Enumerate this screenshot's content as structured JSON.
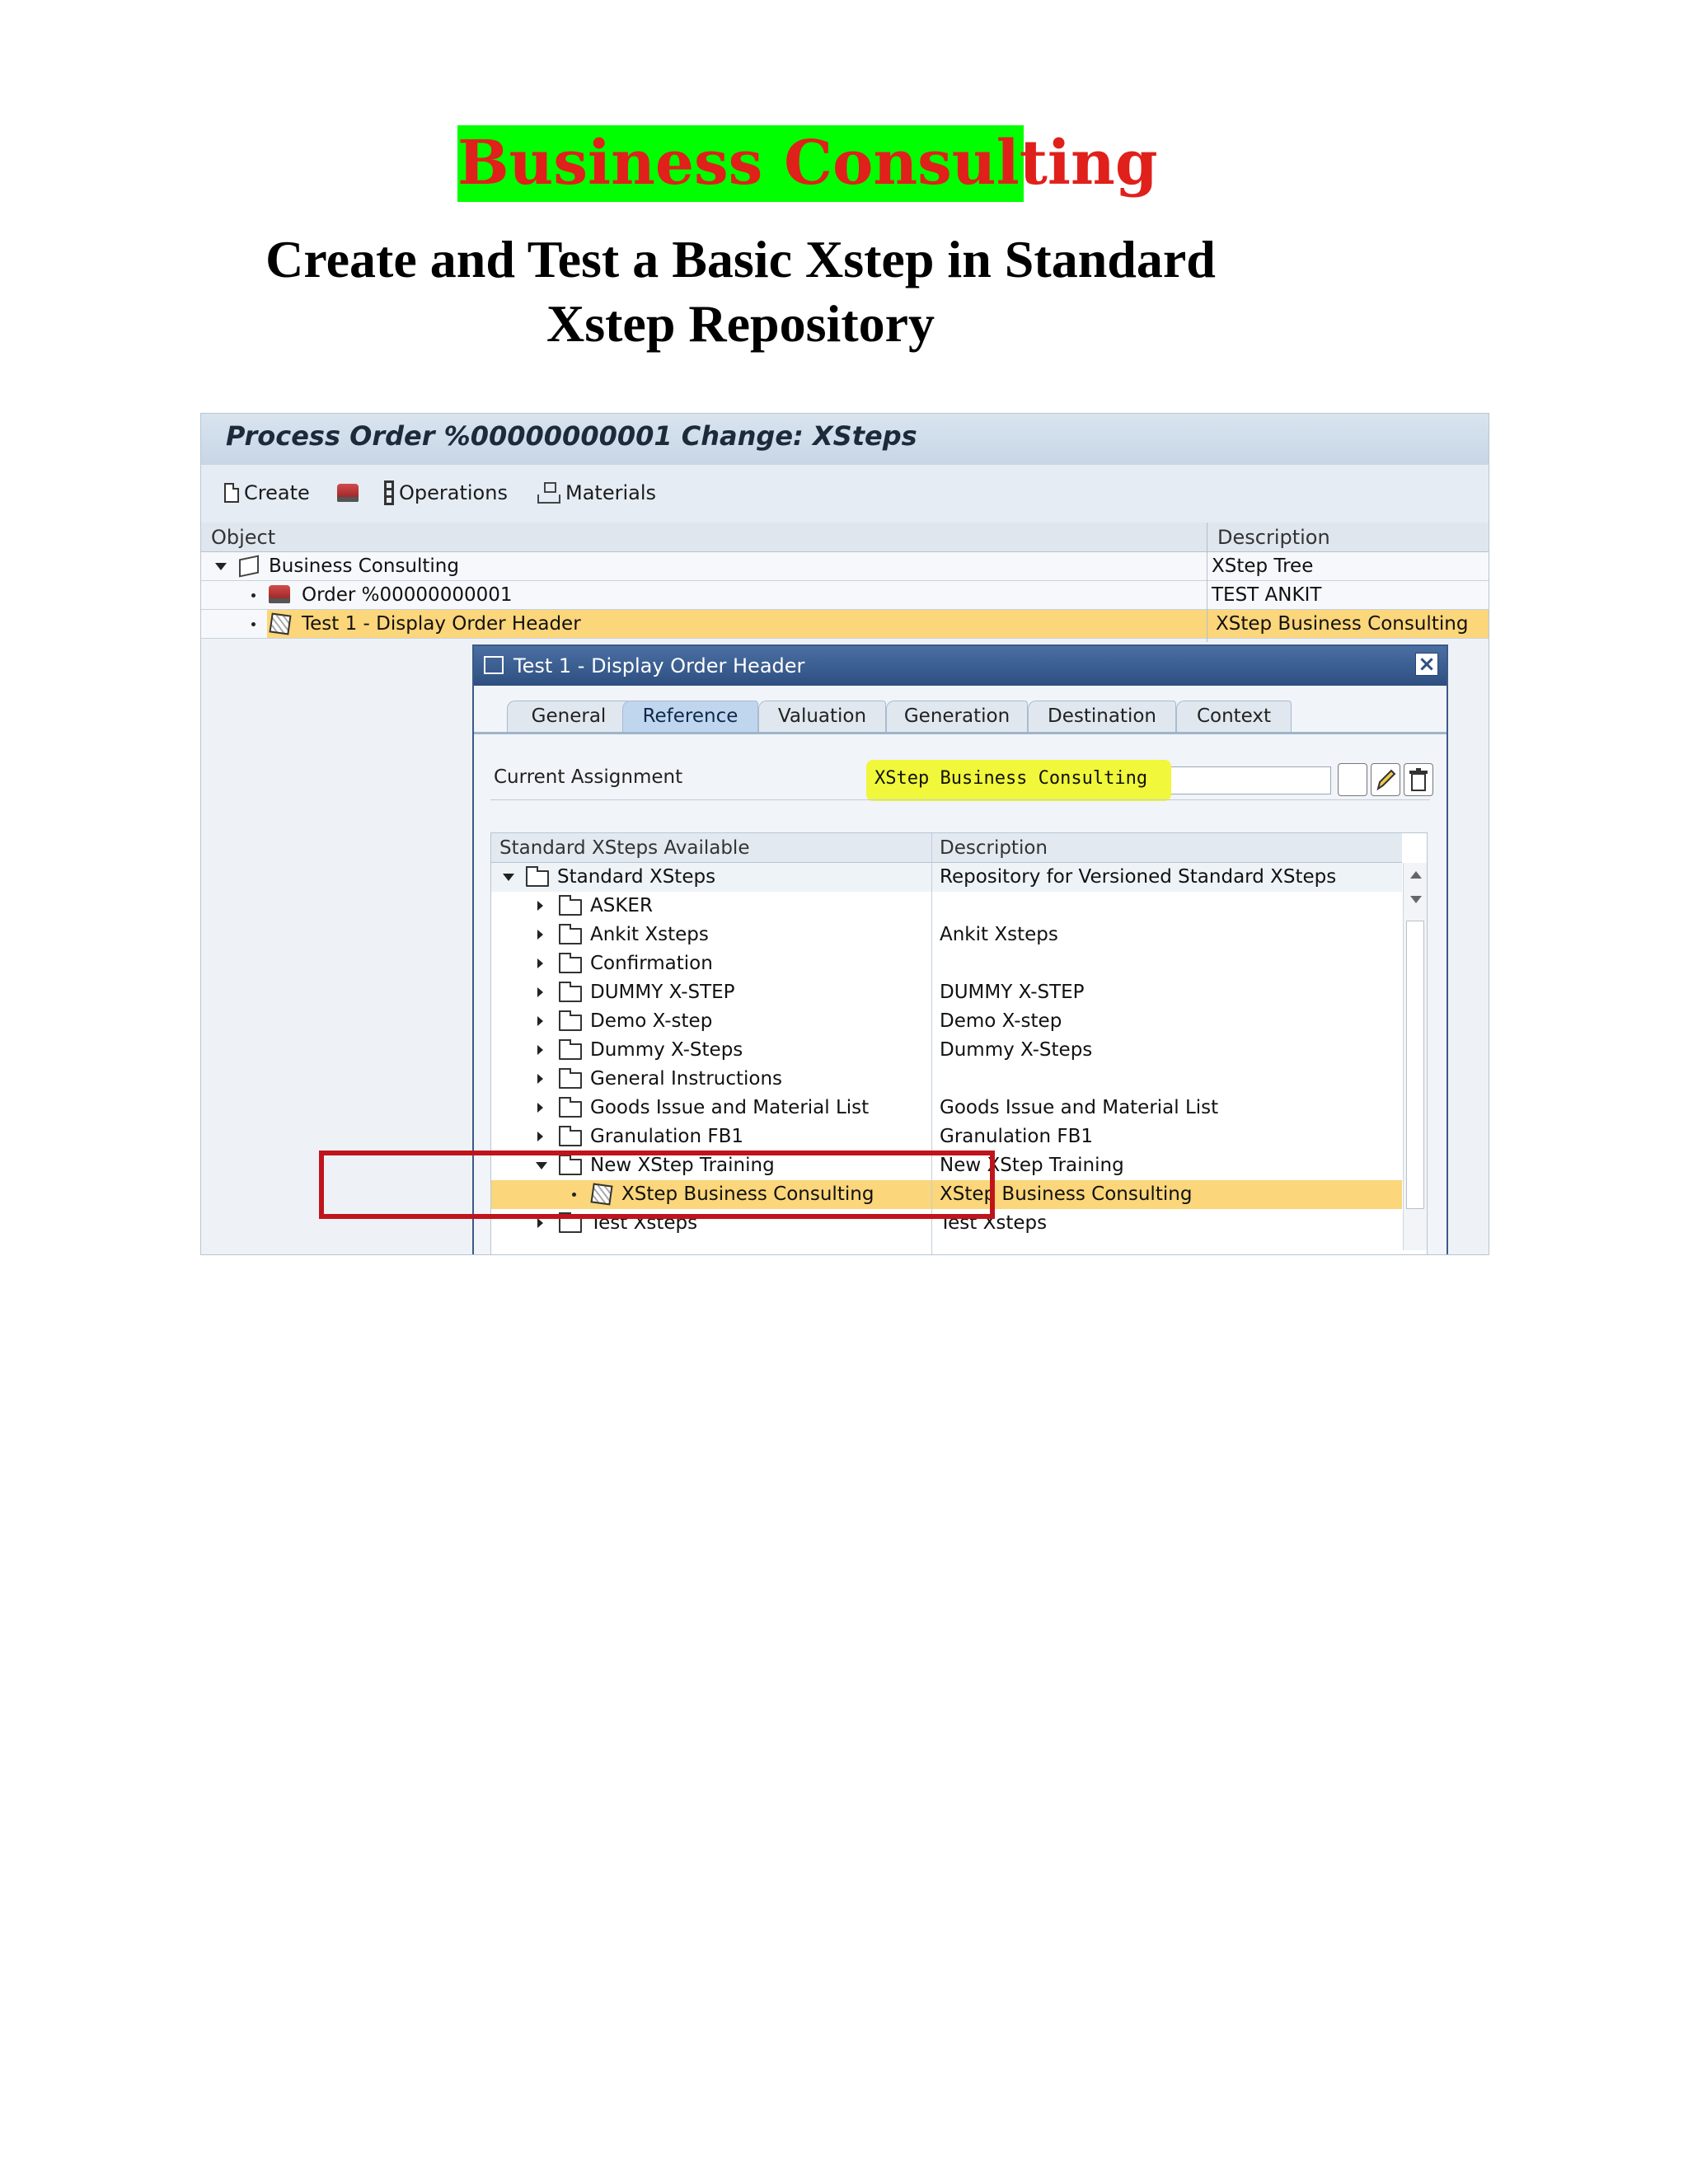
{
  "document": {
    "heading": "Business Consulting",
    "title_line1": "Create and Test a Basic Xstep in Standard",
    "title_line2": "Xstep Repository"
  },
  "window": {
    "title": "Process Order %00000000001 Change: XSteps"
  },
  "toolbar": {
    "create_label": "Create",
    "operations_label": "Operations",
    "materials_label": "Materials"
  },
  "tree": {
    "col_object": "Object",
    "col_description": "Description",
    "rows": [
      {
        "label": "Business Consulting",
        "description": "XStep Tree"
      },
      {
        "label": "Order %00000000001",
        "description": "TEST ANKIT"
      },
      {
        "label": "Test 1 - Display Order Header",
        "description": "XStep Business Consulting"
      }
    ]
  },
  "dialog": {
    "title": "Test 1 - Display Order Header",
    "close_label": "×",
    "tabs": [
      "General",
      "Reference",
      "Valuation",
      "Generation",
      "Destination",
      "Context"
    ],
    "active_tab": "Reference",
    "current_assignment_label": "Current Assignment",
    "current_assignment_value": "XStep Business Consulting",
    "list": {
      "col_available": "Standard XSteps Available",
      "col_description": "Description",
      "rows": [
        {
          "label": "Standard XSteps",
          "description": "Repository for Versioned Standard XSteps"
        },
        {
          "label": "ASKER",
          "description": ""
        },
        {
          "label": "Ankit Xsteps",
          "description": "Ankit Xsteps"
        },
        {
          "label": "Confirmation",
          "description": ""
        },
        {
          "label": "DUMMY X-STEP",
          "description": "DUMMY X-STEP"
        },
        {
          "label": "Demo X-step",
          "description": "Demo X-step"
        },
        {
          "label": "Dummy X-Steps",
          "description": "Dummy X-Steps"
        },
        {
          "label": "General Instructions",
          "description": ""
        },
        {
          "label": "Goods Issue and Material List",
          "description": "Goods Issue and Material List"
        },
        {
          "label": "Granulation FB1",
          "description": "Granulation FB1"
        },
        {
          "label": "New XStep Training",
          "description": "New XStep Training"
        },
        {
          "label": "XStep Business Consulting",
          "description": "XStep Business Consulting"
        },
        {
          "label": "Test Xsteps",
          "description": "Test Xsteps"
        }
      ]
    }
  },
  "colors": {
    "heading_bg": "#00ff00",
    "heading_text": "#e0201b",
    "selection": "#fbd67a",
    "highlight_marker": "#f1f73a",
    "annotation_box": "#c0141c"
  }
}
